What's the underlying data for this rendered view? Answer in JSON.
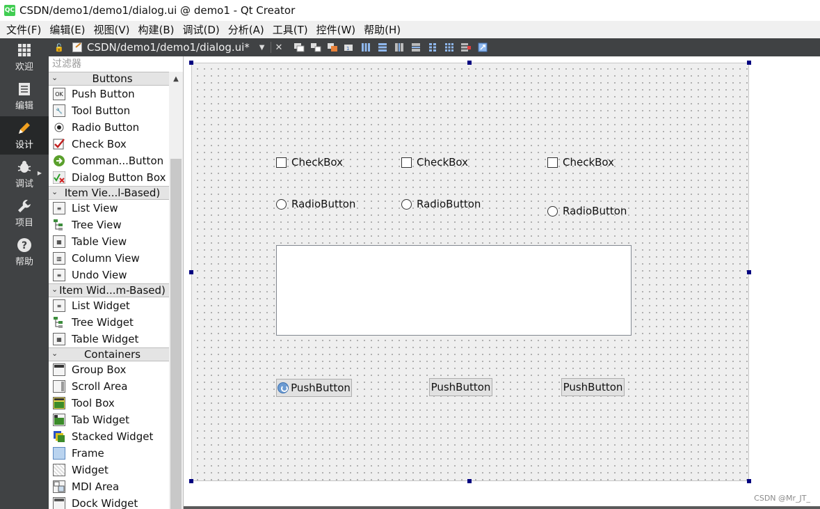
{
  "window": {
    "logo_text": "QC",
    "title": "CSDN/demo1/demo1/dialog.ui @ demo1 - Qt Creator"
  },
  "menubar": {
    "items": [
      "文件(F)",
      "编辑(E)",
      "视图(V)",
      "构建(B)",
      "调试(D)",
      "分析(A)",
      "工具(T)",
      "控件(W)",
      "帮助(H)"
    ]
  },
  "modes": [
    {
      "label": "欢迎",
      "icon": "grid-icon",
      "active": false
    },
    {
      "label": "编辑",
      "icon": "document-icon",
      "active": false
    },
    {
      "label": "设计",
      "icon": "pencil-icon",
      "active": true
    },
    {
      "label": "调试",
      "icon": "bug-icon",
      "active": false
    },
    {
      "label": "项目",
      "icon": "wrench-icon",
      "active": false
    },
    {
      "label": "帮助",
      "icon": "help-icon",
      "active": false
    }
  ],
  "editor": {
    "document_name": "CSDN/demo1/demo1/dialog.ui*",
    "toolbar_icons": [
      "edit-widgets-icon",
      "edit-signals-icon",
      "edit-buddies-icon",
      "edit-tab-order-icon",
      "layout-horizontal-icon",
      "layout-vertical-icon",
      "layout-horizontal-splitter-icon",
      "layout-vertical-splitter-icon",
      "layout-form-icon",
      "layout-grid-icon",
      "break-layout-icon",
      "adjust-size-icon"
    ]
  },
  "widgetbox": {
    "filter_placeholder": "过滤器",
    "categories": [
      {
        "label": "Buttons",
        "items": [
          {
            "label": "Push Button",
            "icon": "push-button-icon"
          },
          {
            "label": "Tool Button",
            "icon": "tool-button-icon"
          },
          {
            "label": "Radio Button",
            "icon": "radio-button-icon"
          },
          {
            "label": "Check Box",
            "icon": "check-box-icon"
          },
          {
            "label": "Comman...Button",
            "icon": "command-link-button-icon"
          },
          {
            "label": "Dialog Button Box",
            "icon": "dialog-button-box-icon"
          }
        ]
      },
      {
        "label": "Item Vie...l-Based)",
        "items": [
          {
            "label": "List View",
            "icon": "list-view-icon"
          },
          {
            "label": "Tree View",
            "icon": "tree-view-icon"
          },
          {
            "label": "Table View",
            "icon": "table-view-icon"
          },
          {
            "label": "Column View",
            "icon": "column-view-icon"
          },
          {
            "label": "Undo View",
            "icon": "undo-view-icon"
          }
        ]
      },
      {
        "label": "Item Wid...m-Based)",
        "items": [
          {
            "label": "List Widget",
            "icon": "list-widget-icon"
          },
          {
            "label": "Tree Widget",
            "icon": "tree-widget-icon"
          },
          {
            "label": "Table Widget",
            "icon": "table-widget-icon"
          }
        ]
      },
      {
        "label": "Containers",
        "items": [
          {
            "label": "Group Box",
            "icon": "group-box-icon"
          },
          {
            "label": "Scroll Area",
            "icon": "scroll-area-icon"
          },
          {
            "label": "Tool Box",
            "icon": "tool-box-icon"
          },
          {
            "label": "Tab Widget",
            "icon": "tab-widget-icon"
          },
          {
            "label": "Stacked Widget",
            "icon": "stacked-widget-icon"
          },
          {
            "label": "Frame",
            "icon": "frame-icon"
          },
          {
            "label": "Widget",
            "icon": "widget-icon"
          },
          {
            "label": "MDI Area",
            "icon": "mdi-area-icon"
          },
          {
            "label": "Dock Widget",
            "icon": "dock-widget-icon"
          }
        ]
      }
    ]
  },
  "form": {
    "checkboxes": [
      "CheckBox",
      "CheckBox",
      "CheckBox"
    ],
    "radiobuttons": [
      "RadioButton",
      "RadioButton",
      "RadioButton"
    ],
    "pushbuttons": [
      "PushButton",
      "PushButton",
      "PushButton"
    ]
  },
  "watermark": "CSDN @Mr_JT_"
}
